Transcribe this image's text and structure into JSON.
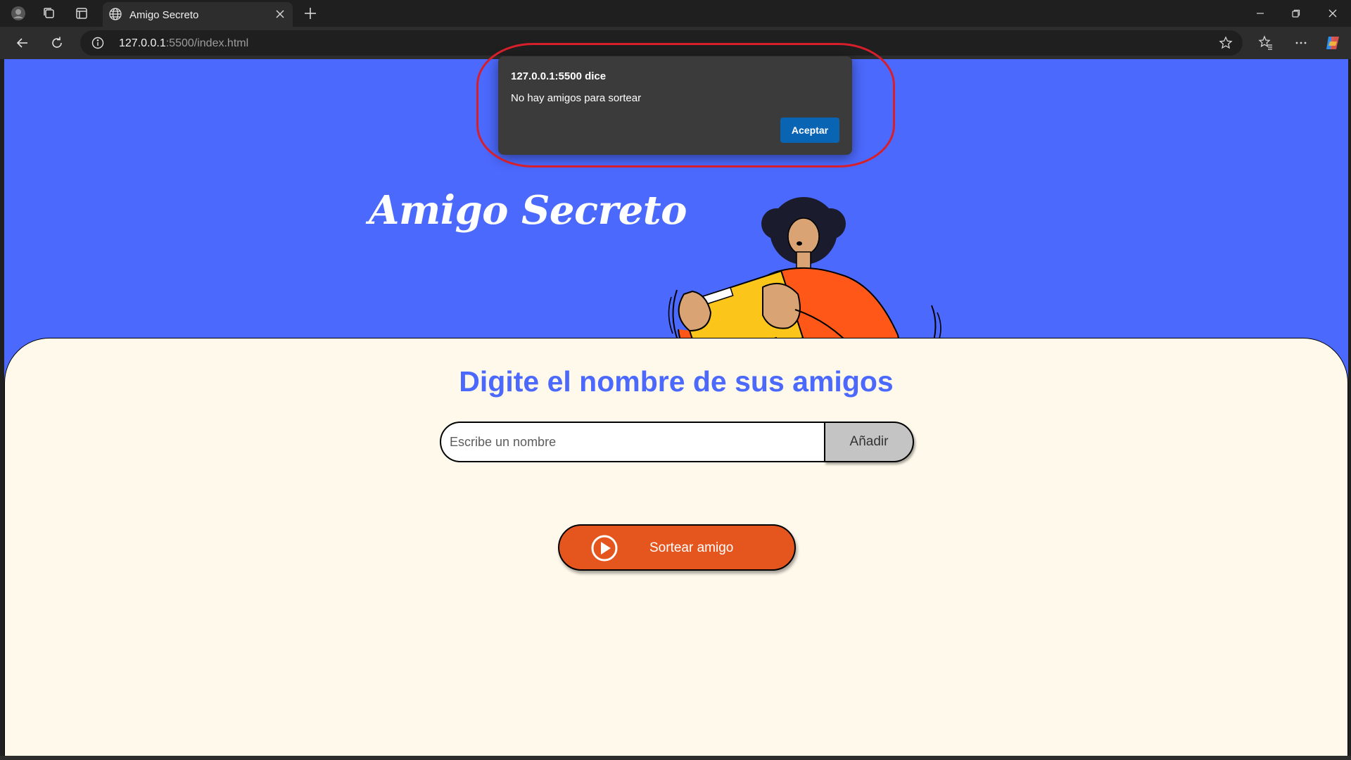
{
  "browser": {
    "tab_title": "Amigo Secreto",
    "url_host": "127.0.0.1",
    "url_rest": ":5500/index.html"
  },
  "page": {
    "hero_title": "Amigo Secreto",
    "section_title": "Digite el nombre de sus amigos",
    "name_input": {
      "placeholder": "Escribe un nombre",
      "value": ""
    },
    "add_button": "Añadir",
    "draw_button": "Sortear amigo"
  },
  "dialog": {
    "title": "127.0.0.1:5500 dice",
    "message": "No hay amigos para sortear",
    "ok_button": "Aceptar"
  },
  "colors": {
    "header_blue": "#4b69fd",
    "content_bg": "#fff9eb",
    "draw_orange": "#e5561f",
    "dialog_button": "#0a64b4",
    "highlight_red": "#d71f2b"
  },
  "icons": [
    "profile-avatar-icon",
    "workspaces-icon",
    "tab-actions-icon",
    "globe-icon",
    "close-icon",
    "plus-icon",
    "minimize-icon",
    "restore-icon",
    "window-close-icon",
    "back-icon",
    "refresh-icon",
    "info-icon",
    "star-icon",
    "favorites-icon",
    "more-icon",
    "copilot-icon",
    "play-circle-icon"
  ]
}
